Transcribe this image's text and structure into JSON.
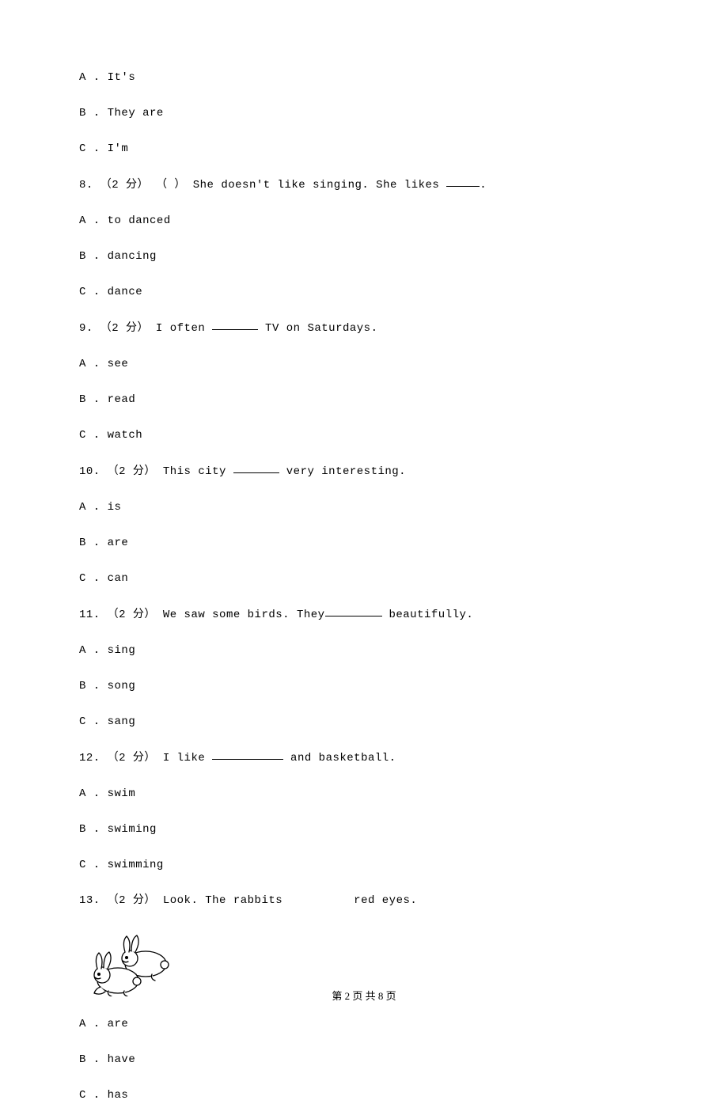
{
  "questions": [
    {
      "num": "",
      "prompt_before": "",
      "prompt_after": "",
      "options": [
        {
          "letter": "A",
          "text": "It's"
        },
        {
          "letter": "B",
          "text": "They are"
        },
        {
          "letter": "C",
          "text": "I'm"
        }
      ]
    },
    {
      "num": "8.",
      "points": "（2 分）",
      "paren": "（   ）",
      "prompt_before": " She doesn't like singing. She likes ",
      "prompt_after": ".",
      "blank": "short",
      "options": [
        {
          "letter": "A",
          "text": "to danced"
        },
        {
          "letter": "B",
          "text": "dancing"
        },
        {
          "letter": "C",
          "text": "dance"
        }
      ]
    },
    {
      "num": "9.",
      "points": "（2 分）",
      "prompt_before": " I often ",
      "prompt_after": " TV on Saturdays.",
      "blank": "med",
      "options": [
        {
          "letter": "A",
          "text": "see"
        },
        {
          "letter": "B",
          "text": "read"
        },
        {
          "letter": "C",
          "text": "watch"
        }
      ]
    },
    {
      "num": "10.",
      "points": "（2 分）",
      "prompt_before": " This city ",
      "prompt_after": " very interesting.",
      "blank": "med",
      "options": [
        {
          "letter": "A",
          "text": "is"
        },
        {
          "letter": "B",
          "text": "are"
        },
        {
          "letter": "C",
          "text": "can"
        }
      ]
    },
    {
      "num": "11.",
      "points": "（2 分）",
      "prompt_before": " We saw some birds. They",
      "prompt_after": " beautifully.",
      "blank": "long",
      "options": [
        {
          "letter": "A",
          "text": "sing"
        },
        {
          "letter": "B",
          "text": "song"
        },
        {
          "letter": "C",
          "text": "sang"
        }
      ]
    },
    {
      "num": "12.",
      "points": "（2 分）",
      "prompt_before": " I like ",
      "prompt_after": " and basketball.",
      "blank": "xlong",
      "options": [
        {
          "letter": "A",
          "text": "swim"
        },
        {
          "letter": "B",
          "text": "swiming"
        },
        {
          "letter": "C",
          "text": "swimming"
        }
      ]
    },
    {
      "num": "13.",
      "points": "（2 分）",
      "prompt_before": " Look. The rabbits",
      "prompt_after": "red eyes.",
      "gap": true,
      "image": "rabbits",
      "options": [
        {
          "letter": "A",
          "text": "are"
        },
        {
          "letter": "B",
          "text": "have"
        },
        {
          "letter": "C",
          "text": "has"
        }
      ]
    }
  ],
  "footer": "第 2 页 共 8 页"
}
